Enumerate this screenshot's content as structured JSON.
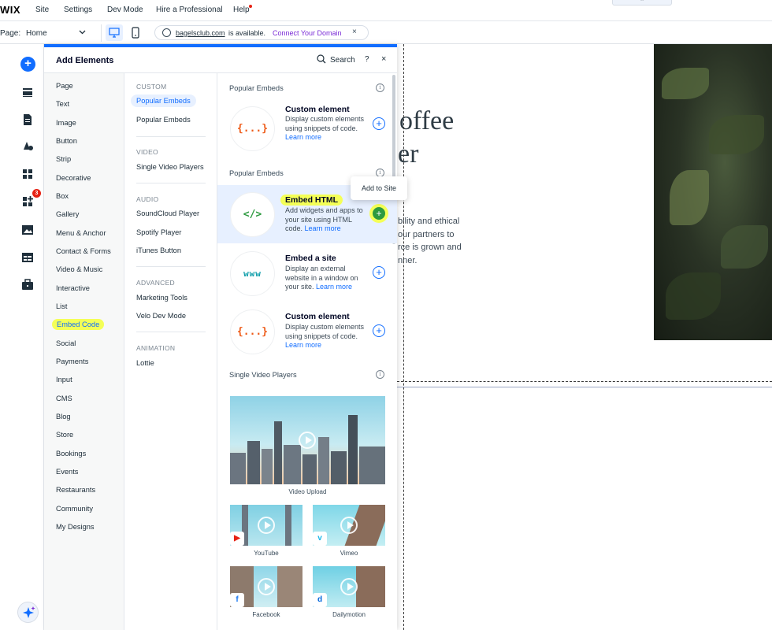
{
  "topbar": {
    "logo": "WIX",
    "menu": [
      "Site",
      "Settings",
      "Dev Mode",
      "Hire a Professional",
      "Help"
    ],
    "collapse_glyph": "⌃"
  },
  "secondbar": {
    "page_label": "Page:",
    "page_value": "Home",
    "domain_name": "bagelsclub.com",
    "domain_status": "is available.",
    "domain_link": "Connect Your Domain",
    "close": "×"
  },
  "lefttool": {
    "add_glyph": "+",
    "badge_count": "3"
  },
  "panel": {
    "title": "Add Elements",
    "search_label": "Search",
    "help": "?",
    "close": "×",
    "categories": [
      "Page",
      "Text",
      "Image",
      "Button",
      "Strip",
      "Decorative",
      "Box",
      "Gallery",
      "Menu & Anchor",
      "Contact & Forms",
      "Video & Music",
      "Interactive",
      "List",
      "Embed Code",
      "Social",
      "Payments",
      "Input",
      "CMS",
      "Blog",
      "Store",
      "Bookings",
      "Events",
      "Restaurants",
      "Community",
      "My Designs"
    ],
    "sections": {
      "custom": {
        "title": "CUSTOM",
        "items": [
          "Popular Embeds",
          "Popular Embeds"
        ]
      },
      "video": {
        "title": "VIDEO",
        "items": [
          "Single Video Players"
        ]
      },
      "audio": {
        "title": "AUDIO",
        "items": [
          "SoundCloud Player",
          "Spotify Player",
          "iTunes Button"
        ]
      },
      "advanced": {
        "title": "ADVANCED",
        "items": [
          "Marketing Tools",
          "Velo Dev Mode"
        ]
      },
      "animation": {
        "title": "ANIMATION",
        "items": [
          "Lottie"
        ]
      }
    },
    "content": {
      "header_popular_1": "Popular Embeds",
      "header_popular_2": "Popular Embeds",
      "header_video": "Single Video Players",
      "info_glyph": "i",
      "cards": [
        {
          "icon": "{...}",
          "title": "Custom element",
          "desc": "Display custom elements using snippets of code.",
          "learn": "Learn more"
        },
        {
          "icon": "</>",
          "title": "Embed HTML",
          "desc": "Add widgets and apps to your site using HTML code.",
          "learn": "Learn more"
        },
        {
          "icon": "www",
          "title": "Embed a site",
          "desc": "Display an external website in a window on your site.",
          "learn": "Learn more"
        },
        {
          "icon": "{...}",
          "title": "Custom element",
          "desc": "Display custom elements using snippets of code.",
          "learn": "Learn more"
        }
      ],
      "plus_glyph": "+",
      "tooltip": "Add to Site",
      "videos": {
        "upload": "Video Upload",
        "youtube": "YouTube",
        "vimeo": "Vimeo",
        "facebook": "Facebook",
        "dailymotion": "Dailymotion"
      }
    }
  },
  "canvas": {
    "hero_line1": "offee",
    "hero_line2": "er",
    "body_lines": [
      "bility and ethical",
      "our partners to",
      "rce is grown and",
      "nner."
    ]
  }
}
